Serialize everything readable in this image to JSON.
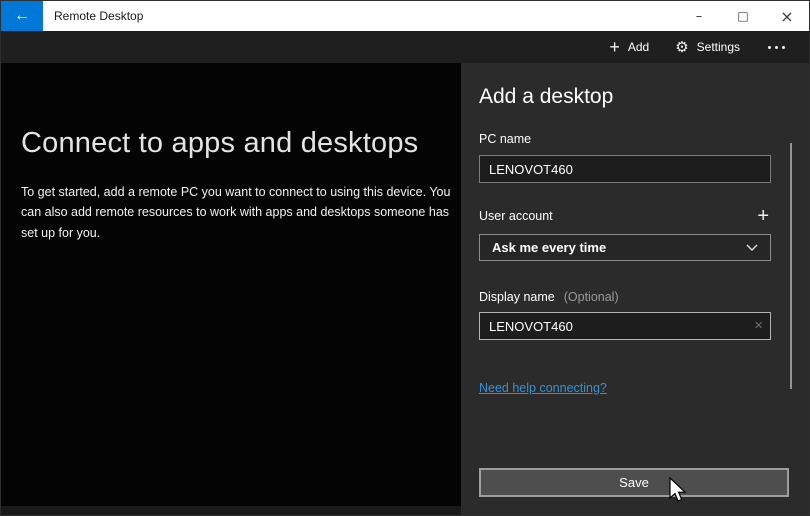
{
  "titlebar": {
    "title": "Remote Desktop"
  },
  "icons": {
    "back": "←",
    "plus": "+",
    "gear": "⚙",
    "minimize": "–",
    "maximize": "□",
    "close": "×",
    "clear": "×"
  },
  "toolbar": {
    "add_label": "Add",
    "settings_label": "Settings"
  },
  "hero": {
    "heading": "Connect to apps and desktops",
    "body": "To get started, add a remote PC you want to connect to using this device. You can also add remote resources to work with apps and desktops someone has set up for you."
  },
  "form": {
    "heading": "Add a desktop",
    "pc_name_label": "PC name",
    "pc_name_value": "LENOVOT460",
    "user_account_label": "User account",
    "user_account_value": "Ask me every time",
    "display_name_label": "Display name",
    "display_name_hint": "(Optional)",
    "display_name_value": "LENOVOT460",
    "help_link_label": "Need help connecting?",
    "save_label": "Save"
  },
  "colors": {
    "accent": "#0078d7",
    "link": "#3392d3",
    "titlebar_bg": "#ffffff",
    "toolbar_bg": "#1f1f1f",
    "hero_bg": "#040404",
    "panel_bg": "#2b2b2b"
  }
}
